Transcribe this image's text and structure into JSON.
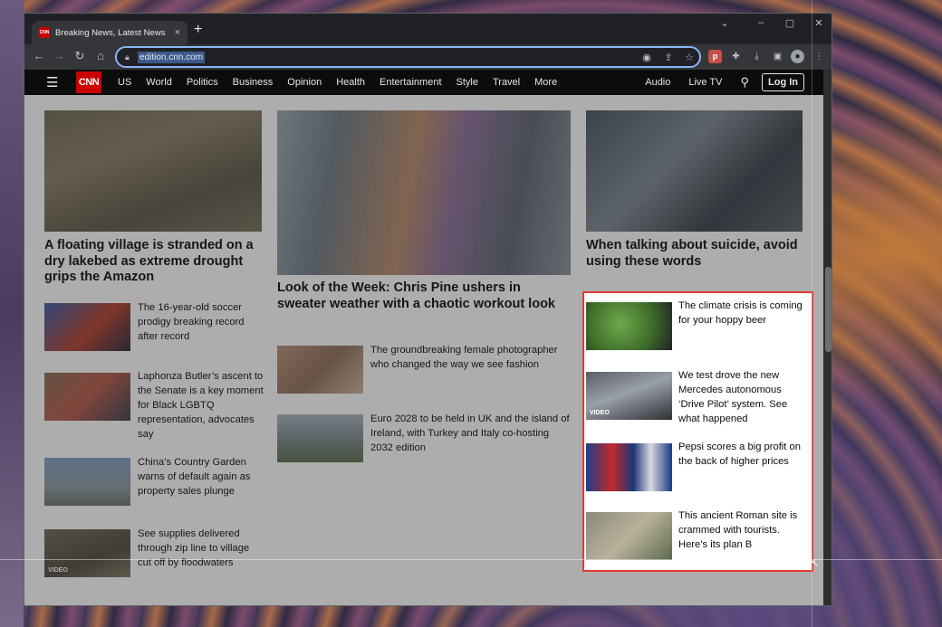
{
  "browser": {
    "tab_title": "Breaking News, Latest News and",
    "tab_favicon": "CNN",
    "new_tab": "+",
    "tab_close": "×",
    "url": "edition.cnn.com",
    "window_controls": [
      "⌄",
      "–",
      "▢",
      "✕"
    ],
    "nav_icons": [
      "arrow-left-icon",
      "arrow-right-icon",
      "reload-icon",
      "home-icon"
    ],
    "omnibox_icons": [
      "google-lens-icon",
      "share-icon",
      "bookmark-star-icon"
    ],
    "extensions": [
      "pocket-extension-icon",
      "puzzle-extensions-icon",
      "download-icon",
      "side-panel-icon",
      "profile-avatar-icon",
      "kebab-menu-icon"
    ]
  },
  "cnn": {
    "logo": "CNN",
    "nav": [
      "US",
      "World",
      "Politics",
      "Business",
      "Opinion",
      "Health",
      "Entertainment",
      "Style",
      "Travel",
      "More"
    ],
    "audio": "Audio",
    "live_tv": "Live TV",
    "login": "Log In"
  },
  "left_column": {
    "lead_headline": "A floating village is stranded on a dry lakebed as extreme drought grips the Amazon",
    "stories": [
      {
        "text": "The 16-year-old soccer prodigy breaking record after record"
      },
      {
        "text": "Laphonza Butler’s ascent to the Senate is a key moment for Black LGBTQ representation, advocates say"
      },
      {
        "text": "China’s Country Garden warns of default again as property sales plunge"
      },
      {
        "text": "See supplies delivered through zip line to village cut off by floodwaters",
        "badge": "VIDEO"
      }
    ]
  },
  "middle_column": {
    "lead_headline": "Look of the Week: Chris Pine ushers in sweater weather with a chaotic workout look",
    "stories": [
      {
        "text": "The groundbreaking female photographer who changed the way we see fashion"
      },
      {
        "text": "Euro 2028 to be held in UK and the island of Ireland, with Turkey and Italy co-hosting 2032 edition"
      }
    ]
  },
  "right_column": {
    "lead_headline": "When talking about suicide, avoid using these words",
    "stories": [
      {
        "text": "The climate crisis is coming for your hoppy beer"
      },
      {
        "text": "We test drove the new Mercedes autonomous ‘Drive Pilot’ system. See what happened",
        "badge": "VIDEO"
      },
      {
        "text": "Pepsi scores a big profit on the back of higher prices"
      },
      {
        "text": "This ancient Roman site is crammed with tourists. Here’s its plan B"
      }
    ]
  },
  "colors": {
    "cnn_red": "#cc0000",
    "highlight": "#e53935",
    "omnibox_focus": "#8ab4f8"
  }
}
